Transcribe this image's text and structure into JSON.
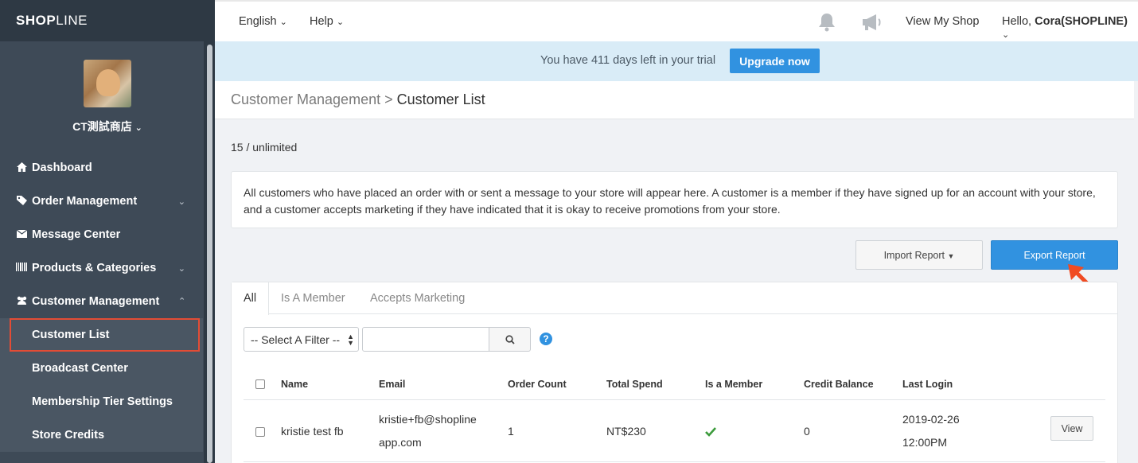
{
  "brand": {
    "logo_bold": "SHOP",
    "logo_light": "LINE"
  },
  "store": {
    "name": "CT測試商店",
    "chevron": "⌄"
  },
  "sidebar": {
    "items": [
      {
        "label": "Dashboard",
        "icon": "home-icon"
      },
      {
        "label": "Order Management",
        "icon": "tag-icon"
      },
      {
        "label": "Message Center",
        "icon": "envelope-icon"
      },
      {
        "label": "Products & Categories",
        "icon": "barcode-icon"
      },
      {
        "label": "Customer Management",
        "icon": "users-icon"
      }
    ],
    "sub_items": [
      {
        "label": "Customer List",
        "active": true
      },
      {
        "label": "Broadcast Center"
      },
      {
        "label": "Membership Tier Settings"
      },
      {
        "label": "Store Credits"
      }
    ]
  },
  "topbar": {
    "language": "English",
    "help": "Help",
    "view_shop": "View My Shop",
    "greeting": "Hello, ",
    "user": "Cora(SHOPLINE)"
  },
  "banner": {
    "text": "You have 411 days left in your trial",
    "button": "Upgrade now"
  },
  "page": {
    "breadcrumb_parent": "Customer Management",
    "breadcrumb_sep": " > ",
    "breadcrumb_current": "Customer List",
    "count": "15 / unlimited",
    "info": "All customers who have placed an order with or sent a message to your store will appear here. A customer is a member if they have signed up for an account with your store, and a customer accepts marketing if they have indicated that it is okay to receive promotions from your store.",
    "import_label": "Import Report",
    "export_label": "Export Report"
  },
  "tabs": [
    "All",
    "Is A Member",
    "Accepts Marketing"
  ],
  "filter": {
    "select_label": "-- Select A Filter --",
    "search_placeholder": ""
  },
  "table": {
    "columns": [
      "Name",
      "Email",
      "Order Count",
      "Total Spend",
      "Is a Member",
      "Credit Balance",
      "Last Login"
    ],
    "rows": [
      {
        "name": "kristie test fb",
        "email_line1": "kristie+fb@shopline",
        "email_line2": "app.com",
        "order_count": "1",
        "total_spend": "NT$230",
        "is_member": true,
        "credit_balance": "0",
        "last_login_date": "2019-02-26",
        "last_login_time": "12:00PM",
        "action": "View"
      }
    ]
  },
  "colors": {
    "accent": "#3192e0",
    "sidebar": "#3e4a57",
    "highlight": "#e34c35",
    "banner": "#d9ecf7"
  }
}
